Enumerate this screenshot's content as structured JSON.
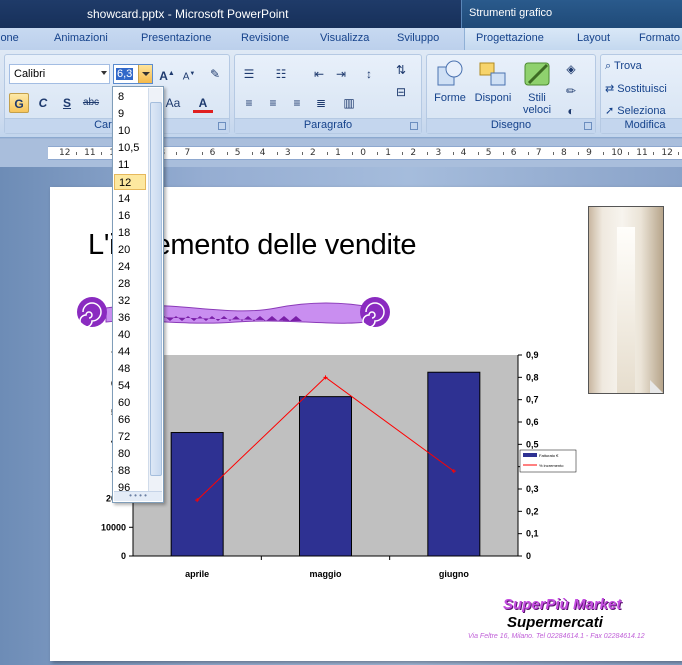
{
  "window": {
    "document_title": "showcard.pptx - Microsoft PowerPoint",
    "contextual_title": "Strumenti grafico"
  },
  "tabs": [
    "ione",
    "Animazioni",
    "Presentazione",
    "Revisione",
    "Visualizza",
    "Sviluppo"
  ],
  "contextual_tabs": [
    "Progettazione",
    "Layout",
    "Formato"
  ],
  "ribbon": {
    "font": {
      "name": "Calibri",
      "size": "6,3",
      "group_label": "Carattere",
      "bold": "G",
      "italic": "C",
      "underline": "S",
      "strike": "abc",
      "change_case": "Aa"
    },
    "paragraph": {
      "group_label": "Paragrafo"
    },
    "drawing": {
      "group_label": "Disegno",
      "shapes": "Forme",
      "arrange": "Disponi",
      "quick_styles": "Stili veloci"
    },
    "editing": {
      "group_label": "Modifica",
      "find": "Trova",
      "replace": "Sostituisci",
      "select": "Seleziona"
    }
  },
  "ruler_labels": [
    "12",
    "11",
    "10",
    "9",
    "8",
    "7",
    "6",
    "5",
    "4",
    "3",
    "2",
    "1",
    "0",
    "1",
    "2",
    "3",
    "4",
    "5",
    "6",
    "7",
    "8",
    "9",
    "10",
    "11",
    "12"
  ],
  "font_size_dropdown": {
    "options": [
      "8",
      "9",
      "10",
      "10,5",
      "11",
      "12",
      "14",
      "16",
      "18",
      "20",
      "24",
      "28",
      "32",
      "36",
      "40",
      "44",
      "48",
      "54",
      "60",
      "66",
      "72",
      "80",
      "88",
      "96"
    ],
    "highlighted": "12"
  },
  "slide": {
    "title": "L'incremento delle vendite",
    "brand_name": "SuperPiù Market",
    "brand_tagline": "Supermercati",
    "address": "Via Feltre 16, Milano. Tel 02284614.1 - Fax 02284614.12"
  },
  "colors": {
    "bar": "#2e3192",
    "line": "#ff0000",
    "plot_bg": "#c0c0c0",
    "ribbon_bg": "#d1def0",
    "accent_purple": "#a040d0"
  },
  "chart_data": {
    "type": "bar",
    "categories": [
      "aprile",
      "maggio",
      "giugno"
    ],
    "series": [
      {
        "name": "Fatturato €",
        "type": "bar",
        "axis": "left",
        "values": [
          430,
          555,
          640
        ]
      },
      {
        "name": "% incremento",
        "type": "line",
        "axis": "right",
        "values": [
          0.25,
          0.8,
          0.38
        ]
      }
    ],
    "y_left_ticks": [
      "700",
      "600",
      "500",
      "400",
      "300",
      "2000",
      "10000",
      "0"
    ],
    "y_right_ticks": [
      "0,9",
      "0,8",
      "0,7",
      "0,6",
      "0,5",
      "0,4",
      "0,3",
      "0,2",
      "0,1",
      "0"
    ],
    "ylim_left": [
      0,
      700
    ],
    "ylim_right": [
      0,
      0.9
    ],
    "legend": "right",
    "grid": false
  }
}
